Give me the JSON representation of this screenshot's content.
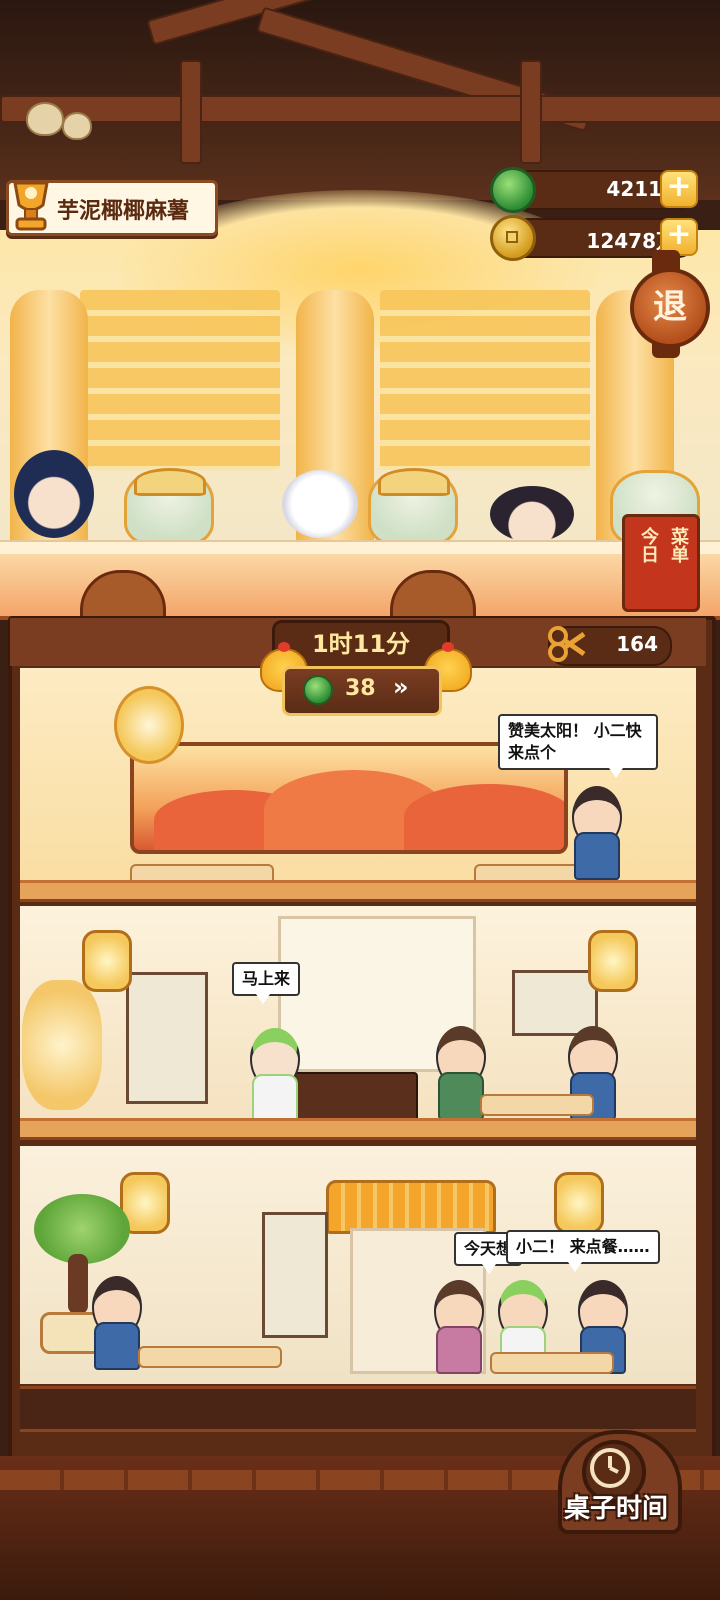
{
  "player": {
    "name": "芋泥椰椰麻薯",
    "icon": "rank-trophy-icon"
  },
  "resources": {
    "jade": {
      "value": "42111",
      "icon": "jade-coin-icon"
    },
    "gold": {
      "value": "12478万",
      "icon": "gold-coin-icon"
    }
  },
  "exit_label": "退",
  "menu_sign": {
    "line1": "今日",
    "line2": "菜单"
  },
  "shop": {
    "timer": "1时11分",
    "speed_cost": "38",
    "speed_arrows": "»",
    "pass_count": "164"
  },
  "bubbles": {
    "room1_waiter": "赞美太阳！ 小二快来点个",
    "room2_waiter": "马上来",
    "room3_guest_a": "今天想",
    "room3_guest_b": "小二！ 来点餐……"
  },
  "bottom_button": {
    "label": "桌子时间",
    "icon": "clock-icon"
  },
  "colors": {
    "wood": "#5a2c16",
    "gold": "#f1c35a",
    "jade": "#2e8d34",
    "accent_red": "#c3361d"
  }
}
